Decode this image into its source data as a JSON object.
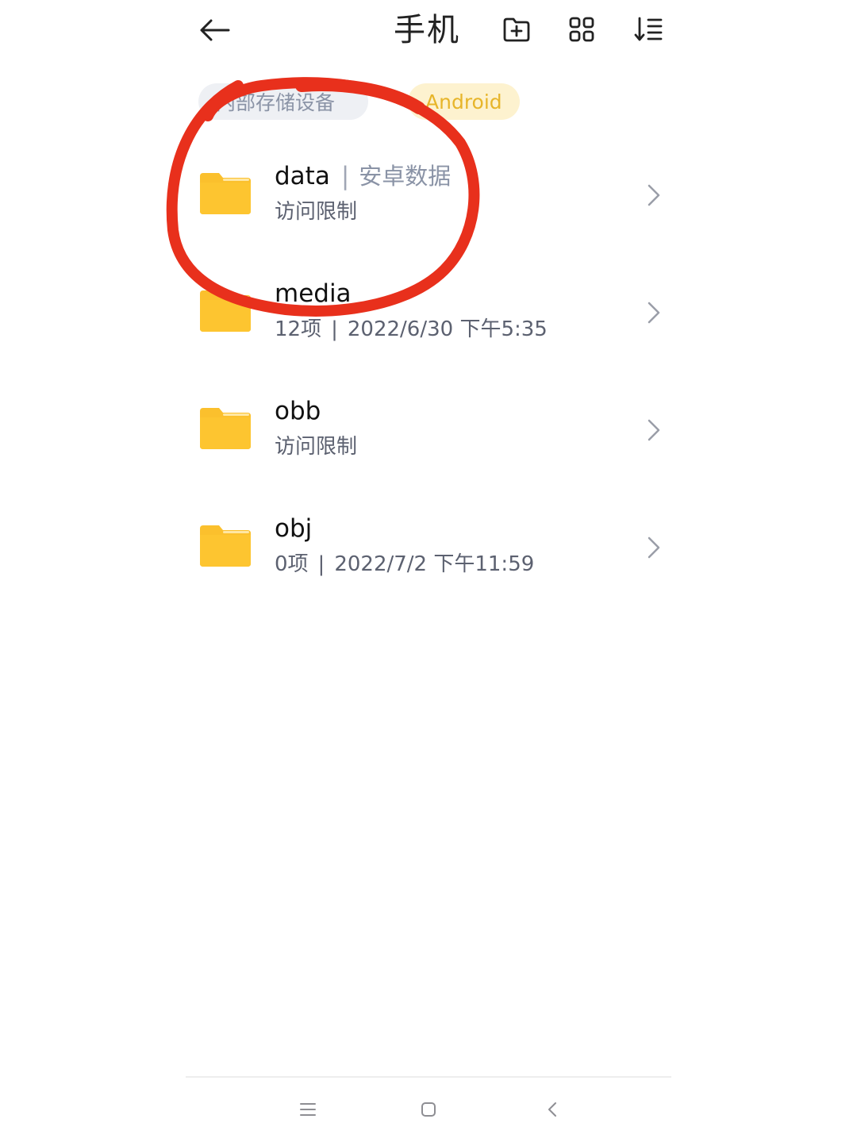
{
  "header": {
    "title": "手机",
    "icons": {
      "back": "arrow-left-icon",
      "new_folder": "folder-plus-icon",
      "grid": "grid-view-icon",
      "sort": "sort-list-icon"
    }
  },
  "breadcrumb": {
    "root_label": "内部存储设备",
    "current_label": "Android"
  },
  "files": [
    {
      "name": "data",
      "tag": "安卓数据",
      "meta": "访问限制",
      "count": "",
      "date": ""
    },
    {
      "name": "media",
      "tag": "",
      "meta": "",
      "count": "12项",
      "date": "2022/6/30 下午5:35"
    },
    {
      "name": "obb",
      "tag": "",
      "meta": "访问限制",
      "count": "",
      "date": ""
    },
    {
      "name": "obj",
      "tag": "",
      "meta": "",
      "count": "0项",
      "date": "2022/7/2 下午11:59"
    }
  ],
  "separator": "|",
  "colors": {
    "folder": "#fbc02d",
    "folder_tab": "#f9b825",
    "annotation_red": "#e8301c",
    "breadcrumb_accent": "#e7b52a"
  },
  "navbar": {
    "icons": [
      "menu-icon",
      "home-square-icon",
      "back-chevron-icon"
    ]
  }
}
